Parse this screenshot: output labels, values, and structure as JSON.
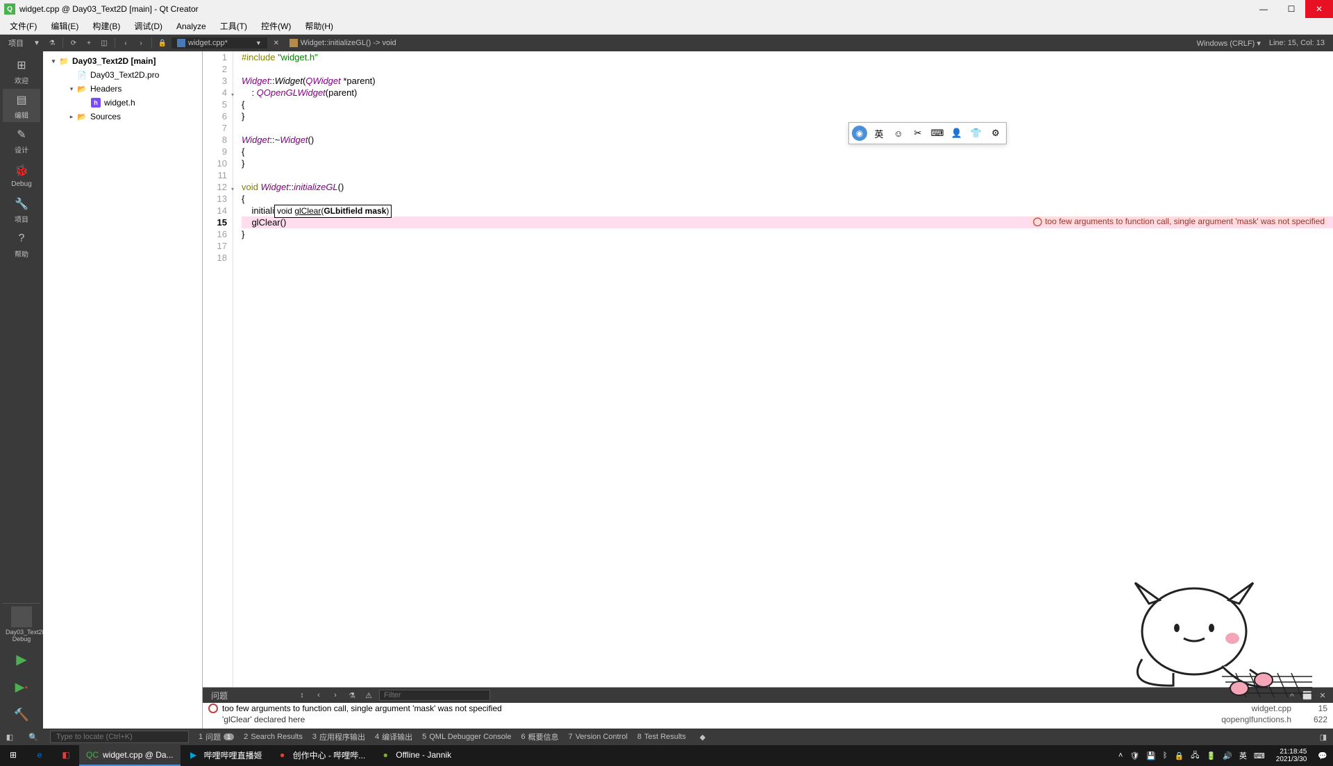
{
  "window": {
    "title": "widget.cpp @ Day03_Text2D [main] - Qt Creator"
  },
  "menu": {
    "items": [
      "文件(F)",
      "编辑(E)",
      "构建(B)",
      "调试(D)",
      "Analyze",
      "工具(T)",
      "控件(W)",
      "帮助(H)"
    ]
  },
  "toolbar": {
    "project_label": "项目",
    "file_name": "widget.cpp*",
    "scope": "Widget::initializeGL() -> void",
    "encoding": "Windows (CRLF)",
    "position": "Line: 15, Col: 13"
  },
  "mode_bar": {
    "items": [
      {
        "label": "欢迎",
        "icon": "⊞"
      },
      {
        "label": "编辑",
        "icon": "▤",
        "active": true
      },
      {
        "label": "设计",
        "icon": "✎"
      },
      {
        "label": "Debug",
        "icon": "🐞"
      },
      {
        "label": "项目",
        "icon": "🔧"
      },
      {
        "label": "帮助",
        "icon": "?"
      }
    ],
    "kit": {
      "name": "Day03_Text2D",
      "config": "Debug"
    }
  },
  "project_tree": {
    "items": [
      {
        "label": "Day03_Text2D [main]",
        "depth": 0,
        "expand": "▾",
        "icon": "icon-project"
      },
      {
        "label": "Day03_Text2D.pro",
        "depth": 1,
        "expand": "",
        "icon": "icon-pro"
      },
      {
        "label": "Headers",
        "depth": 1,
        "expand": "▾",
        "icon": "icon-folder"
      },
      {
        "label": "widget.h",
        "depth": 2,
        "expand": "",
        "icon": "icon-h"
      },
      {
        "label": "Sources",
        "depth": 1,
        "expand": "▸",
        "icon": "icon-folder"
      }
    ]
  },
  "editor": {
    "lines": [
      {
        "n": 1,
        "html": "<span class='kw'>#include</span> <span class='str'>\"widget.h\"</span>"
      },
      {
        "n": 2,
        "html": ""
      },
      {
        "n": 3,
        "html": "<span class='typ'>Widget</span>::<span class='fn'>Widget</span>(<span class='typ'>QWidget</span> *parent)"
      },
      {
        "n": 4,
        "html": "    : <span class='typ'>QOpenGLWidget</span>(parent)",
        "fold": "▾"
      },
      {
        "n": 5,
        "html": "{"
      },
      {
        "n": 6,
        "html": "}"
      },
      {
        "n": 7,
        "html": ""
      },
      {
        "n": 8,
        "html": "<span class='typ'>Widget</span>::~<span class='typ fn'>Widget</span>()"
      },
      {
        "n": 9,
        "html": "{"
      },
      {
        "n": 10,
        "html": "}"
      },
      {
        "n": 11,
        "html": ""
      },
      {
        "n": 12,
        "html": "<span class='kw'>void</span> <span class='typ'>Widget</span>::<span class='typ fn'>initializeGL</span>()",
        "fold": "▾"
      },
      {
        "n": 13,
        "html": "{"
      },
      {
        "n": 14,
        "html": "    initiali<span class='hint-box'>void <u>glClear</u>(<span class='param'>GLbitfield mask</span>)</span>"
      },
      {
        "n": 15,
        "html": "    glClear()",
        "current": true,
        "bp": true,
        "error": true
      },
      {
        "n": 16,
        "html": "}"
      },
      {
        "n": 17,
        "html": ""
      },
      {
        "n": 18,
        "html": ""
      }
    ],
    "inline_error": "too few arguments to function call, single argument 'mask' was not specified"
  },
  "ime": {
    "lang": "英"
  },
  "output": {
    "tab": "问题",
    "filter_placeholder": "Filter",
    "issues": [
      {
        "type": "error",
        "msg": "too few arguments to function call, single argument 'mask' was not specified",
        "file": "widget.cpp",
        "line": "15"
      },
      {
        "type": "note",
        "msg": "'glClear' declared here",
        "file": "qopenglfunctions.h",
        "line": "622"
      }
    ]
  },
  "bottom_tabs": {
    "locator_placeholder": "Type to locate (Ctrl+K)",
    "items": [
      {
        "n": "1",
        "label": "问题",
        "badge": "1"
      },
      {
        "n": "2",
        "label": "Search Results"
      },
      {
        "n": "3",
        "label": "应用程序输出"
      },
      {
        "n": "4",
        "label": "编译输出"
      },
      {
        "n": "5",
        "label": "QML Debugger Console"
      },
      {
        "n": "6",
        "label": "概要信息"
      },
      {
        "n": "7",
        "label": "Version Control"
      },
      {
        "n": "8",
        "label": "Test Results"
      }
    ]
  },
  "taskbar": {
    "apps": [
      {
        "label": "",
        "icon": "⊞",
        "color": "#fff"
      },
      {
        "label": "",
        "icon": "e",
        "color": "#0078d7"
      },
      {
        "label": "",
        "icon": "◧",
        "color": "#e04040"
      },
      {
        "label": "widget.cpp @ Da...",
        "icon": "QC",
        "color": "#4caf50",
        "active": true
      },
      {
        "label": "哔哩哔哩直播姬",
        "icon": "▶",
        "color": "#00a1d6"
      },
      {
        "label": "创作中心 - 哔哩哔...",
        "icon": "●",
        "color": "#ea4335"
      },
      {
        "label": "Offline - Jannik",
        "icon": "●",
        "color": "#7bb32e"
      }
    ],
    "time": "21:18:45",
    "date": "2021/3/30"
  }
}
